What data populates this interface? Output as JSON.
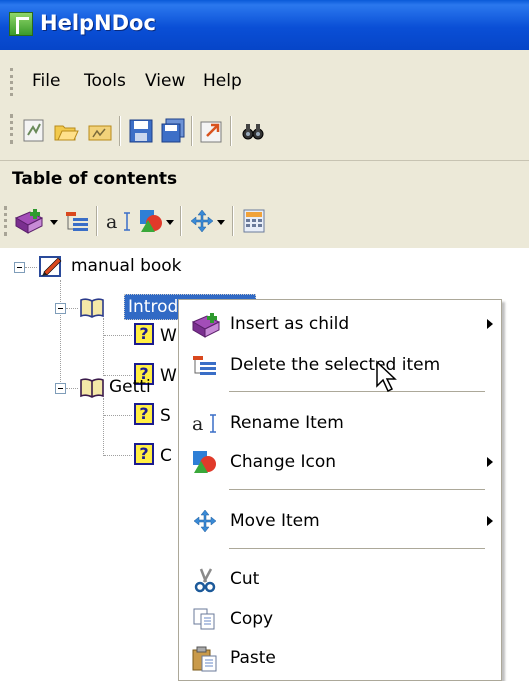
{
  "window": {
    "title": "HelpNDoc"
  },
  "menubar": {
    "items": [
      "File",
      "Tools",
      "View",
      "Help"
    ]
  },
  "toolbar": {
    "icons": [
      "new-project-icon",
      "open-project-icon",
      "open-recent-icon",
      "save-icon",
      "save-all-icon",
      "export-icon",
      "find-icon"
    ]
  },
  "toc": {
    "header": "Table of contents",
    "toolbar_icons": [
      "add-topic-icon",
      "delete-topic-icon",
      "rename-topic-icon",
      "change-icon-icon",
      "move-topic-icon",
      "calculator-icon"
    ]
  },
  "tree": {
    "root": {
      "label": "manual book",
      "icon": "edit-book-icon"
    },
    "nodes": [
      {
        "label": "Introd",
        "icon": "open-book-icon",
        "selected": true
      },
      {
        "label": "W",
        "icon": "help-topic-icon"
      },
      {
        "label": "W",
        "icon": "help-topic-icon"
      },
      {
        "label": "Getti",
        "icon": "open-book-icon"
      },
      {
        "label": "S",
        "icon": "help-topic-icon"
      },
      {
        "label": "C",
        "icon": "help-topic-icon"
      }
    ]
  },
  "context_menu": {
    "items": [
      {
        "label": "Insert as child",
        "icon": "insert-child-icon",
        "submenu": true
      },
      {
        "label": "Delete the selected item",
        "icon": "delete-item-icon",
        "submenu": false
      },
      {
        "label": "Rename Item",
        "icon": "rename-icon",
        "submenu": false
      },
      {
        "label": "Change Icon",
        "icon": "change-icon-icon",
        "submenu": true
      },
      {
        "label": "Move Item",
        "icon": "move-icon",
        "submenu": true
      },
      {
        "label": "Cut",
        "icon": "scissors-icon",
        "submenu": false
      },
      {
        "label": "Copy",
        "icon": "copy-icon",
        "submenu": false
      },
      {
        "label": "Paste",
        "icon": "paste-icon",
        "submenu": false
      }
    ]
  },
  "colors": {
    "titlebar": "#0a4fd6",
    "selection": "#316ac5",
    "chrome": "#ece9d8"
  }
}
